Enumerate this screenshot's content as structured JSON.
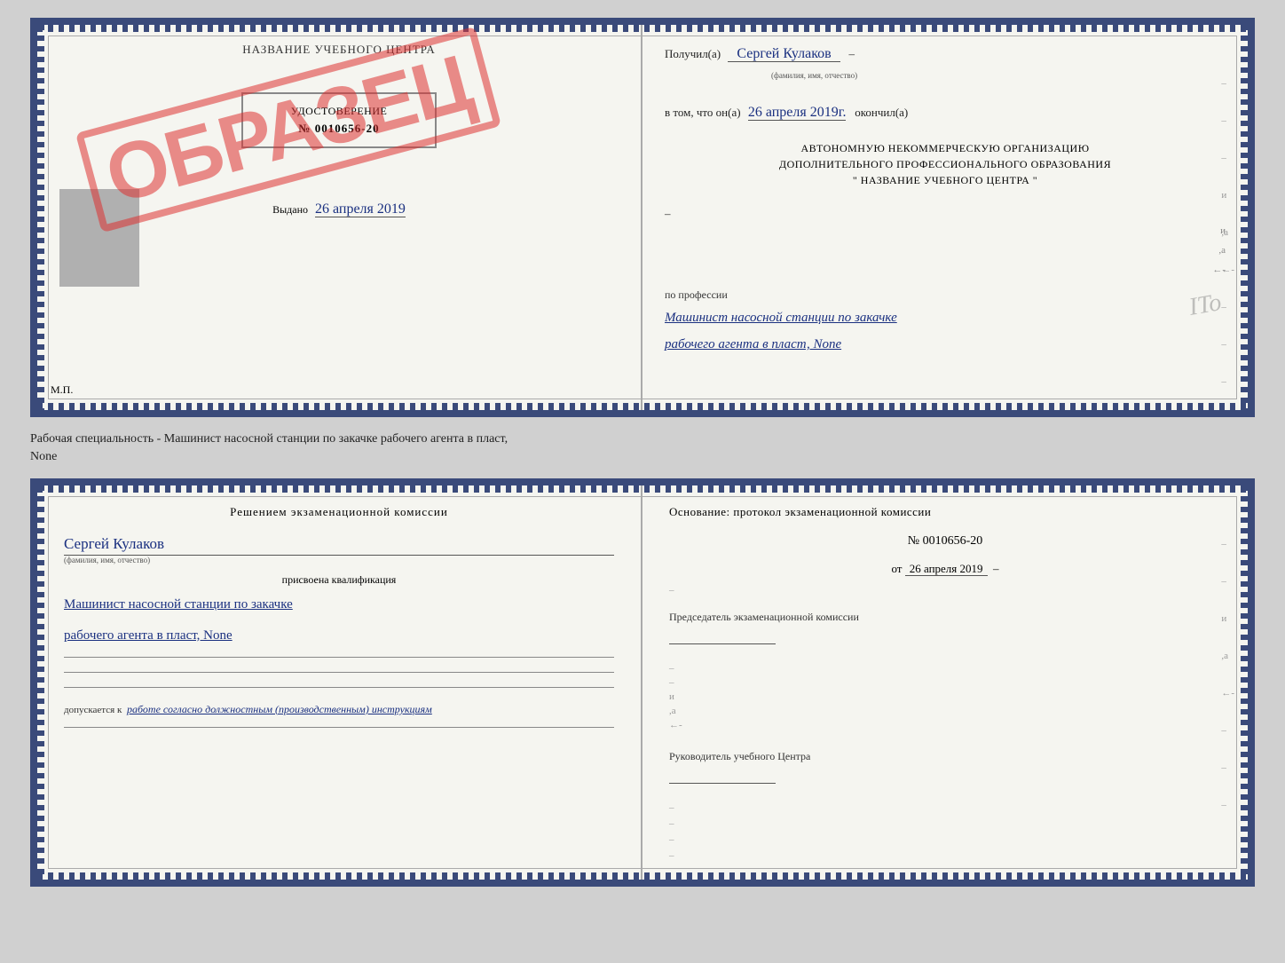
{
  "top_doc": {
    "left": {
      "title": "НАЗВАНИЕ УЧЕБНОГО ЦЕНТРА",
      "stamp": "ОБРАЗЕЦ",
      "cert_title": "УДОСТОВЕРЕНИЕ",
      "cert_number": "№ 0010656-20",
      "issued_label": "Выдано",
      "issued_date": "26 апреля 2019",
      "mp_label": "М.П."
    },
    "right": {
      "received_label": "Получил(а)",
      "received_name": "Сергей Кулаков",
      "received_name_sub": "(фамилия, имя, отчество)",
      "date_label": "в том, что он(а)",
      "date_value": "26 апреля 2019г.",
      "date_suffix": "окончил(а)",
      "org_line1": "АВТОНОМНУЮ НЕКОММЕРЧЕСКУЮ ОРГАНИЗАЦИЮ",
      "org_line2": "ДОПОЛНИТЕЛЬНОГО ПРОФЕССИОНАЛЬНОГО ОБРАЗОВАНИЯ",
      "org_line3": "\" НАЗВАНИЕ УЧЕБНОГО ЦЕНТРА \"",
      "profession_label": "по профессии",
      "profession_line1": "Машинист насосной станции по закачке",
      "profession_line2": "рабочего агента в пласт, None",
      "ito_text": "ITo"
    }
  },
  "separator": {
    "text": "Рабочая специальность - Машинист насосной станции по закачке рабочего агента в пласт,",
    "text2": "None"
  },
  "bottom_doc": {
    "left": {
      "decision_title": "Решением экзаменационной комиссии",
      "name": "Сергей Кулаков",
      "name_sub": "(фамилия, имя, отчество)",
      "assigned_label": "присвоена квалификация",
      "qualification_line1": "Машинист насосной станции по закачке",
      "qualification_line2": "рабочего агента в пласт, None",
      "work_label": "допускается к",
      "work_value": "работе согласно должностным (производственным) инструкциям"
    },
    "right": {
      "basis_title": "Основание: протокол экзаменационной комиссии",
      "protocol_number": "№ 0010656-20",
      "protocol_date_prefix": "от",
      "protocol_date": "26 апреля 2019",
      "chairman_label": "Председатель экзаменационной комиссии",
      "director_label": "Руководитель учебного Центра"
    }
  }
}
